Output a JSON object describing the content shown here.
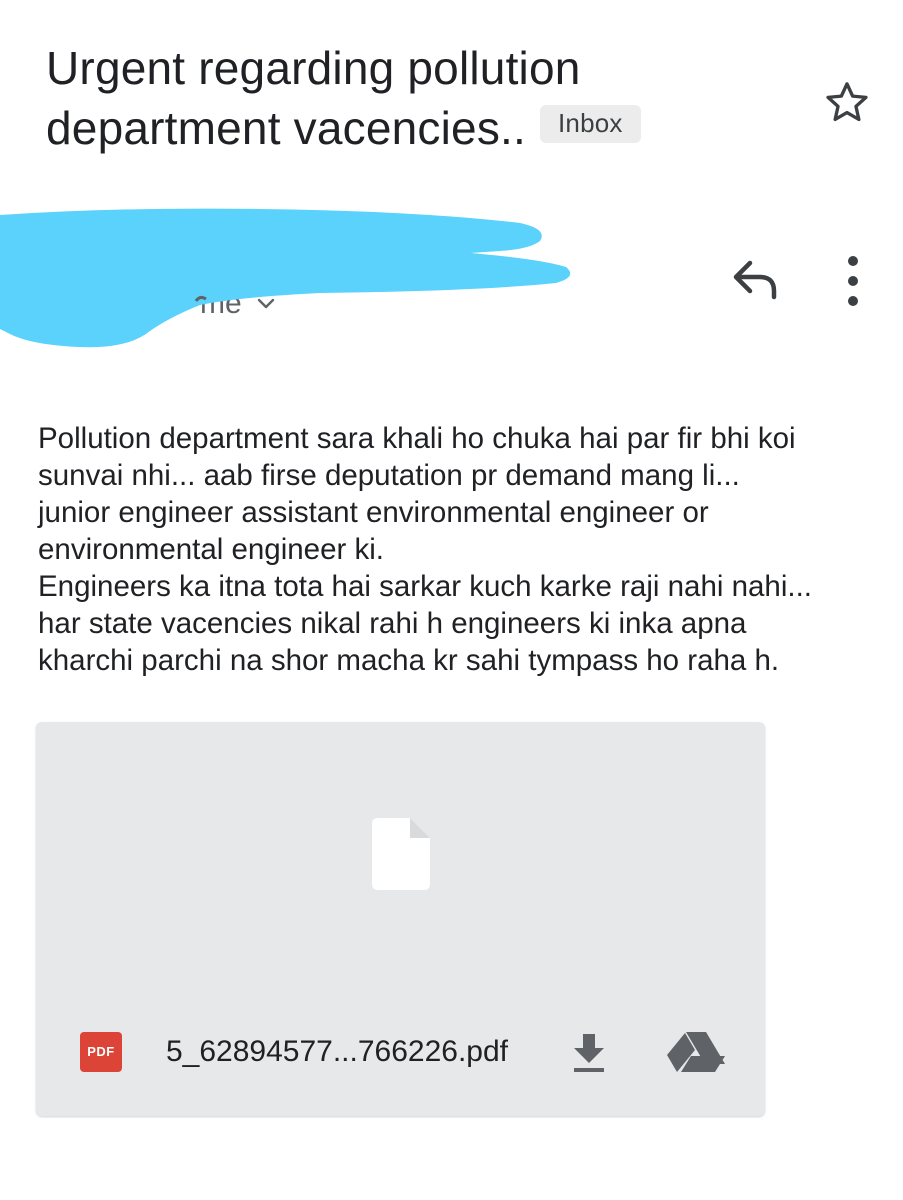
{
  "email": {
    "subject_line1": "Urgent regarding pollution",
    "subject_line2": "department vacencies..",
    "label": "Inbox",
    "recipient": "me",
    "body": [
      "Pollution department sara khali ho chuka hai par fir bhi koi",
      "sunvai nhi... aab firse deputation pr demand mang li...",
      "junior engineer assistant environmental engineer or",
      "environmental engineer ki.",
      "Engineers ka itna tota hai sarkar kuch karke raji nahi nahi...",
      "har state vacencies nikal rahi h engineers ki inka apna",
      "kharchi parchi na shor macha kr sahi tympass ho raha h."
    ]
  },
  "attachment": {
    "type_badge": "PDF",
    "file_name": "5_62894577...766226.pdf"
  },
  "icons": {
    "star": "star-outline-icon",
    "reply": "reply-icon",
    "more": "more-vert-icon",
    "chevron": "chevron-down-icon",
    "file": "file-icon",
    "download": "download-icon",
    "drive": "google-drive-icon"
  },
  "colors": {
    "redaction": "#5ad2fb",
    "pdf_red": "#dc4437",
    "attachment_bg": "#e7e8ea",
    "chip_bg": "#ececec"
  }
}
